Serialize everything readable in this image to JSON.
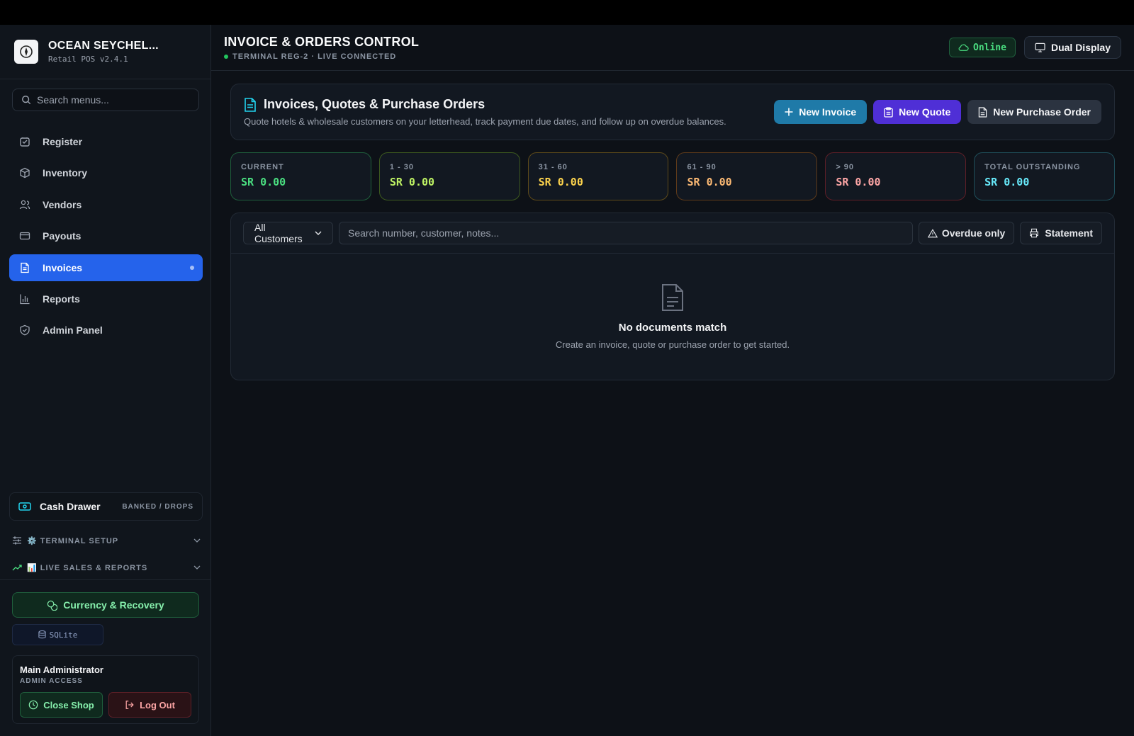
{
  "brand": {
    "name": "OCEAN SEYCHEL...",
    "version": "Retail POS v2.4.1"
  },
  "sidebar": {
    "search_placeholder": "Search menus...",
    "items": [
      {
        "label": "Register",
        "icon": "register-icon"
      },
      {
        "label": "Inventory",
        "icon": "box-icon"
      },
      {
        "label": "Vendors",
        "icon": "users-icon"
      },
      {
        "label": "Payouts",
        "icon": "card-icon"
      },
      {
        "label": "Invoices",
        "icon": "document-icon",
        "active": true
      },
      {
        "label": "Reports",
        "icon": "bar-chart-icon"
      },
      {
        "label": "Admin Panel",
        "icon": "shield-icon"
      }
    ],
    "cash_drawer": {
      "label": "Cash Drawer",
      "tag": "BANKED / DROPS"
    },
    "sections": [
      {
        "label": "⚙️ TERMINAL SETUP"
      },
      {
        "label": "📊 LIVE SALES & REPORTS"
      }
    ],
    "currency_button": "Currency & Recovery",
    "db_badge": "SQLite",
    "user": {
      "name": "Main Administrator",
      "role": "ADMIN ACCESS",
      "close_shop": "Close Shop",
      "logout": "Log Out"
    }
  },
  "header": {
    "title": "INVOICE & ORDERS CONTROL",
    "subtitle": "TERMINAL REG-2 · LIVE CONNECTED",
    "status": "Online",
    "dual_display": "Dual Display"
  },
  "panel": {
    "title": "Invoices, Quotes & Purchase Orders",
    "description": "Quote hotels & wholesale customers on your letterhead, track payment due dates, and follow up on overdue balances.",
    "new_invoice": "New Invoice",
    "new_quote": "New Quote",
    "new_po": "New Purchase Order"
  },
  "aging": [
    {
      "label": "CURRENT",
      "value": "SR 0.00",
      "color": "#4ade80",
      "border": "#1f5e3c"
    },
    {
      "label": "1 - 30",
      "value": "SR 0.00",
      "color": "#bef264",
      "border": "#3d5a1f"
    },
    {
      "label": "31 - 60",
      "value": "SR 0.00",
      "color": "#fcd34d",
      "border": "#5e4a1a"
    },
    {
      "label": "61 - 90",
      "value": "SR 0.00",
      "color": "#fdba74",
      "border": "#5e3a1a"
    },
    {
      "label": "> 90",
      "value": "SR 0.00",
      "color": "#fca5a5",
      "border": "#5e1f27"
    },
    {
      "label": "TOTAL OUTSTANDING",
      "value": "SR 0.00",
      "color": "#67e8f9",
      "border": "#1f4f5a"
    }
  ],
  "filters": {
    "customer_select": "All Customers",
    "search_placeholder": "Search number, customer, notes...",
    "overdue_only": "Overdue only",
    "statement": "Statement"
  },
  "empty_state": {
    "title": "No documents match",
    "subtitle": "Create an invoice, quote or purchase order to get started."
  },
  "colors": {
    "accent": "#2563eb",
    "invoice": "#1f7aa8",
    "quote": "#4f2fd6"
  }
}
